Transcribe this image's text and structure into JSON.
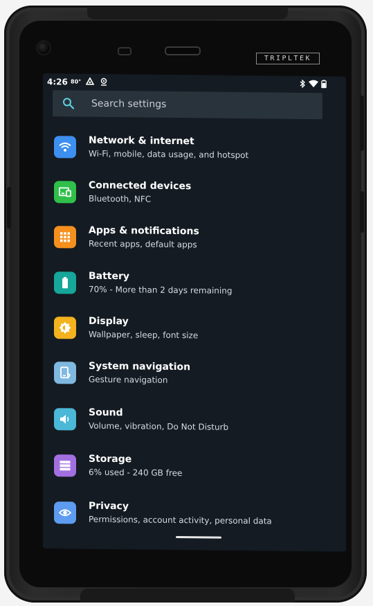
{
  "device": {
    "brand": "TRIPLTEK"
  },
  "status_bar": {
    "time": "4:26",
    "temperature": "80°",
    "left_icons": [
      "assistant-icon",
      "location-icon"
    ],
    "right_icons": [
      "bluetooth-icon",
      "wifi-icon",
      "battery-icon"
    ]
  },
  "search": {
    "placeholder": "Search settings"
  },
  "settings": [
    {
      "title": "Network & internet",
      "subtitle": "Wi-Fi, mobile, data usage, and hotspot",
      "icon": "wifi-icon",
      "color": "#3d8ff0"
    },
    {
      "title": "Connected devices",
      "subtitle": "Bluetooth, NFC",
      "icon": "devices-icon",
      "color": "#2fbf4a"
    },
    {
      "title": "Apps & notifications",
      "subtitle": "Recent apps, default apps",
      "icon": "apps-grid-icon",
      "color": "#f5901e"
    },
    {
      "title": "Battery",
      "subtitle": "70% - More than 2 days remaining",
      "icon": "battery-icon",
      "color": "#16a69a"
    },
    {
      "title": "Display",
      "subtitle": "Wallpaper, sleep, font size",
      "icon": "brightness-icon",
      "color": "#f3b21e"
    },
    {
      "title": "System navigation",
      "subtitle": "Gesture navigation",
      "icon": "phone-gesture-icon",
      "color": "#7fb8e0"
    },
    {
      "title": "Sound",
      "subtitle": "Volume, vibration, Do Not Disturb",
      "icon": "volume-icon",
      "color": "#4ab8d6"
    },
    {
      "title": "Storage",
      "subtitle": "6% used - 240 GB free",
      "icon": "storage-icon",
      "color": "#a26fe0"
    },
    {
      "title": "Privacy",
      "subtitle": "Permissions, account activity, personal data",
      "icon": "privacy-eye-icon",
      "color": "#5d9cf0"
    }
  ]
}
